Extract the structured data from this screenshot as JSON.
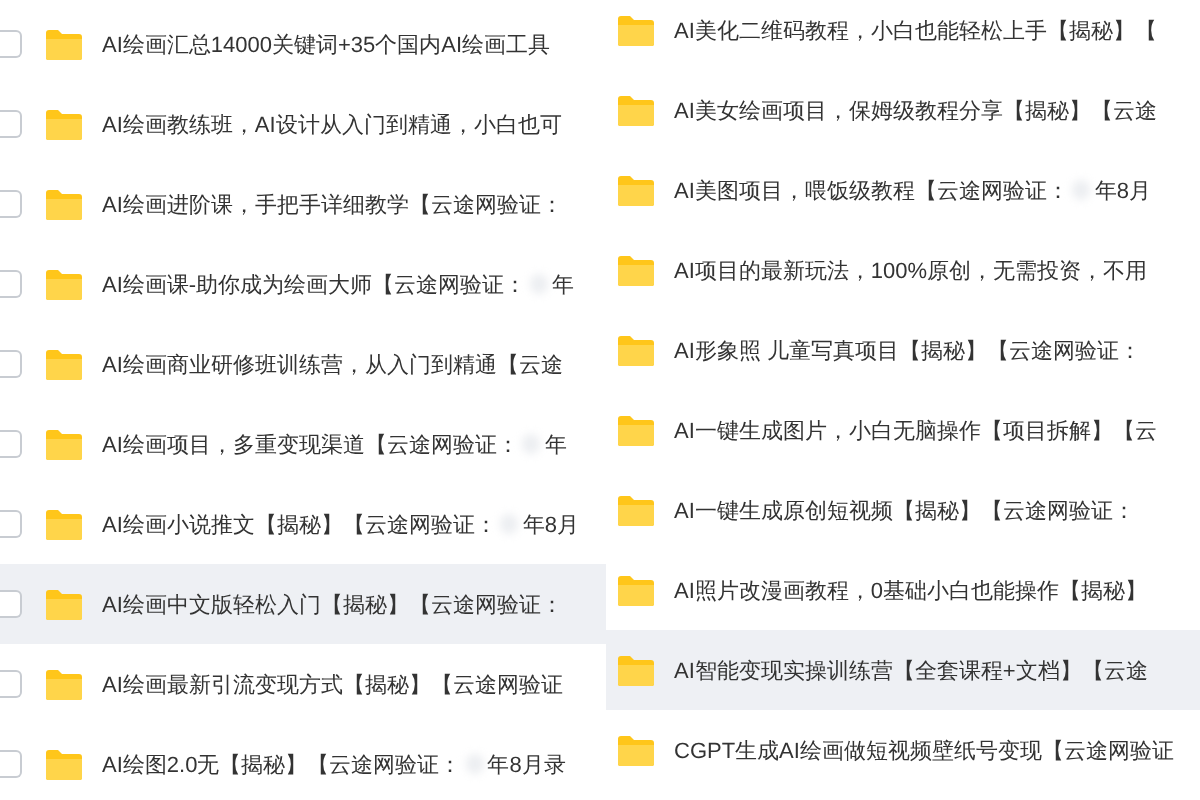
{
  "panels": [
    {
      "kind": "checklist",
      "rows": [
        {
          "name": "AI绘画汇总14000关键词+35个国内AI绘画工具",
          "hovered": false
        },
        {
          "name": "AI绘画教练班，AI设计从入门到精通，小白也可",
          "hovered": false
        },
        {
          "name": "AI绘画进阶课，手把手详细教学【云途网验证：",
          "hovered": false
        },
        {
          "name": "AI绘画课-助你成为绘画大师【云途网验证：",
          "tail": "年",
          "hovered": false
        },
        {
          "name": "AI绘画商业研修班训练营，从入门到精通【云途",
          "hovered": false
        },
        {
          "name": "AI绘画项目，多重变现渠道【云途网验证：",
          "tail": "年",
          "hovered": false
        },
        {
          "name": "AI绘画小说推文【揭秘】【云途网验证：",
          "tail": "年8月",
          "hovered": false
        },
        {
          "name": "AI绘画中文版轻松入门【揭秘】【云途网验证：",
          "hovered": true
        },
        {
          "name": "AI绘画最新引流变现方式【揭秘】【云途网验证",
          "hovered": false
        },
        {
          "name": "AI绘图2.0无【揭秘】【云途网验证：",
          "tail": "年8月录",
          "hovered": false
        }
      ]
    },
    {
      "kind": "list",
      "rows": [
        {
          "name": "AI美化二维码教程，小白也能轻松上手【揭秘】【",
          "hovered": false
        },
        {
          "name": "AI美女绘画项目，保姆级教程分享【揭秘】【云途",
          "hovered": false
        },
        {
          "name": "AI美图项目，喂饭级教程【云途网验证：",
          "tail": "年8月",
          "hovered": false
        },
        {
          "name": "AI项目的最新玩法，100%原创，无需投资，不用",
          "hovered": false
        },
        {
          "name": "AI形象照 儿童写真项目【揭秘】【云途网验证：",
          "hovered": false
        },
        {
          "name": "AI一键生成图片，小白无脑操作【项目拆解】【云",
          "hovered": false
        },
        {
          "name": "AI一键生成原创短视频【揭秘】【云途网验证：",
          "hovered": false
        },
        {
          "name": "AI照片改漫画教程，0基础小白也能操作【揭秘】",
          "hovered": false
        },
        {
          "name": "AI智能变现实操训练营【全套课程+文档】【云途",
          "hovered": true
        },
        {
          "name": "CGPT生成AI绘画做短视频壁纸号变现【云途网验证",
          "hovered": false
        }
      ]
    }
  ]
}
